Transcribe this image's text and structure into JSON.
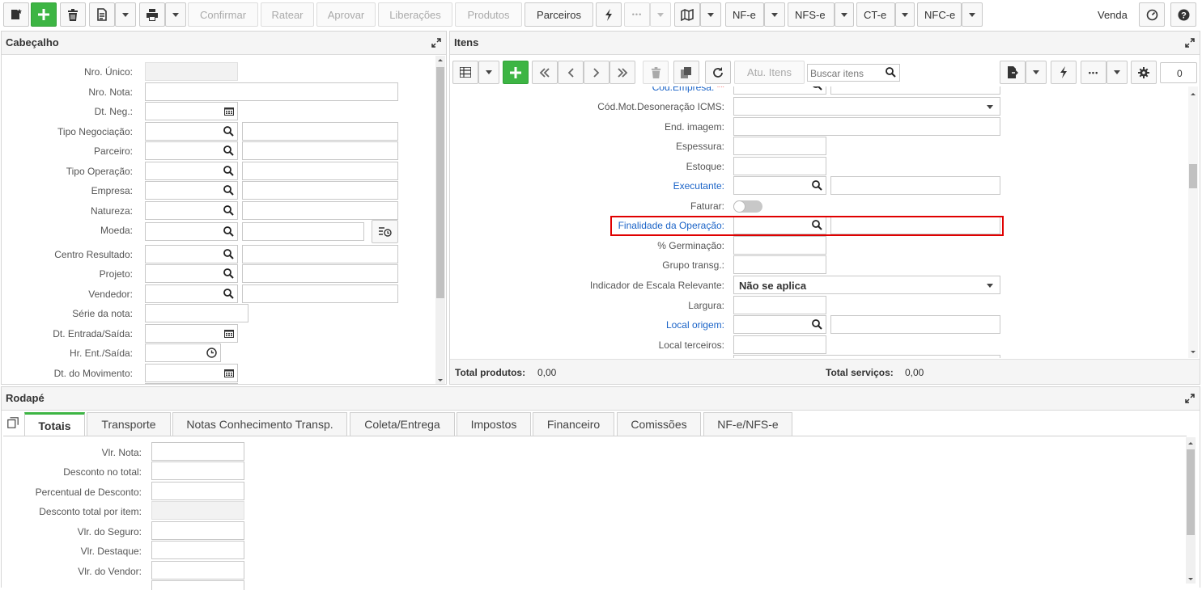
{
  "toolbar": {
    "confirmar": "Confirmar",
    "ratear": "Ratear",
    "aprovar": "Aprovar",
    "liberacoes": "Liberações",
    "produtos": "Produtos",
    "parceiros": "Parceiros",
    "more": "•••",
    "nfe": "NF-e",
    "nfse": "NFS-e",
    "cte": "CT-e",
    "nfce": "NFC-e",
    "venda": "Venda"
  },
  "cabecalho": {
    "title": "Cabeçalho",
    "fields": {
      "nro_unico": "Nro. Único:",
      "nro_nota": "Nro. Nota:",
      "dt_neg": "Dt. Neg.:",
      "tipo_negociacao": "Tipo Negociação:",
      "parceiro": "Parceiro:",
      "tipo_operacao": "Tipo Operação:",
      "empresa": "Empresa:",
      "natureza": "Natureza:",
      "moeda": "Moeda:",
      "centro_resultado": "Centro Resultado:",
      "projeto": "Projeto:",
      "vendedor": "Vendedor:",
      "serie_nota": "Série da nota:",
      "dt_entrada_saida": "Dt. Entrada/Saída:",
      "hr_ent_saida": "Hr. Ent./Saída:",
      "dt_movimento": "Dt. do Movimento:"
    }
  },
  "itens": {
    "title": "Itens",
    "atu_itens": "Atu. Itens",
    "search_placeholder": "Buscar itens",
    "count": "0",
    "fields": {
      "cod_empresa": "Cód.Empresa:",
      "cod_mot_deson": "Cód.Mot.Desoneração ICMS:",
      "end_imagem": "End. imagem:",
      "espessura": "Espessura:",
      "estoque": "Estoque:",
      "executante": "Executante:",
      "faturar": "Faturar:",
      "finalidade": "Finalidade da Operação:",
      "germinacao": "% Germinação:",
      "grupo_transg": "Grupo transg.:",
      "indicador_escala": "Indicador de Escala Relevante:",
      "indicador_escala_value": "Não se aplica",
      "largura": "Largura:",
      "local_origem": "Local origem:",
      "local_terceiros": "Local terceiros:"
    },
    "total_produtos_label": "Total produtos:",
    "total_produtos_value": "0,00",
    "total_servicos_label": "Total serviços:",
    "total_servicos_value": "0,00"
  },
  "rodape": {
    "title": "Rodapé",
    "tabs": [
      "Totais",
      "Transporte",
      "Notas Conhecimento Transp.",
      "Coleta/Entrega",
      "Impostos",
      "Financeiro",
      "Comissões",
      "NF-e/NFS-e"
    ],
    "fields": {
      "vlr_nota": "Vlr. Nota:",
      "desconto_total": "Desconto no total:",
      "percentual_desconto": "Percentual de Desconto:",
      "desconto_por_item": "Desconto total por item:",
      "vlr_seguro": "Vlr. do Seguro:",
      "vlr_destaque": "Vlr. Destaque:",
      "vlr_vendor": "Vlr. do Vendor:"
    }
  },
  "colors": {
    "accent_green": "#3db544",
    "link_blue": "#1a63c7",
    "highlight_red": "#e00000"
  }
}
